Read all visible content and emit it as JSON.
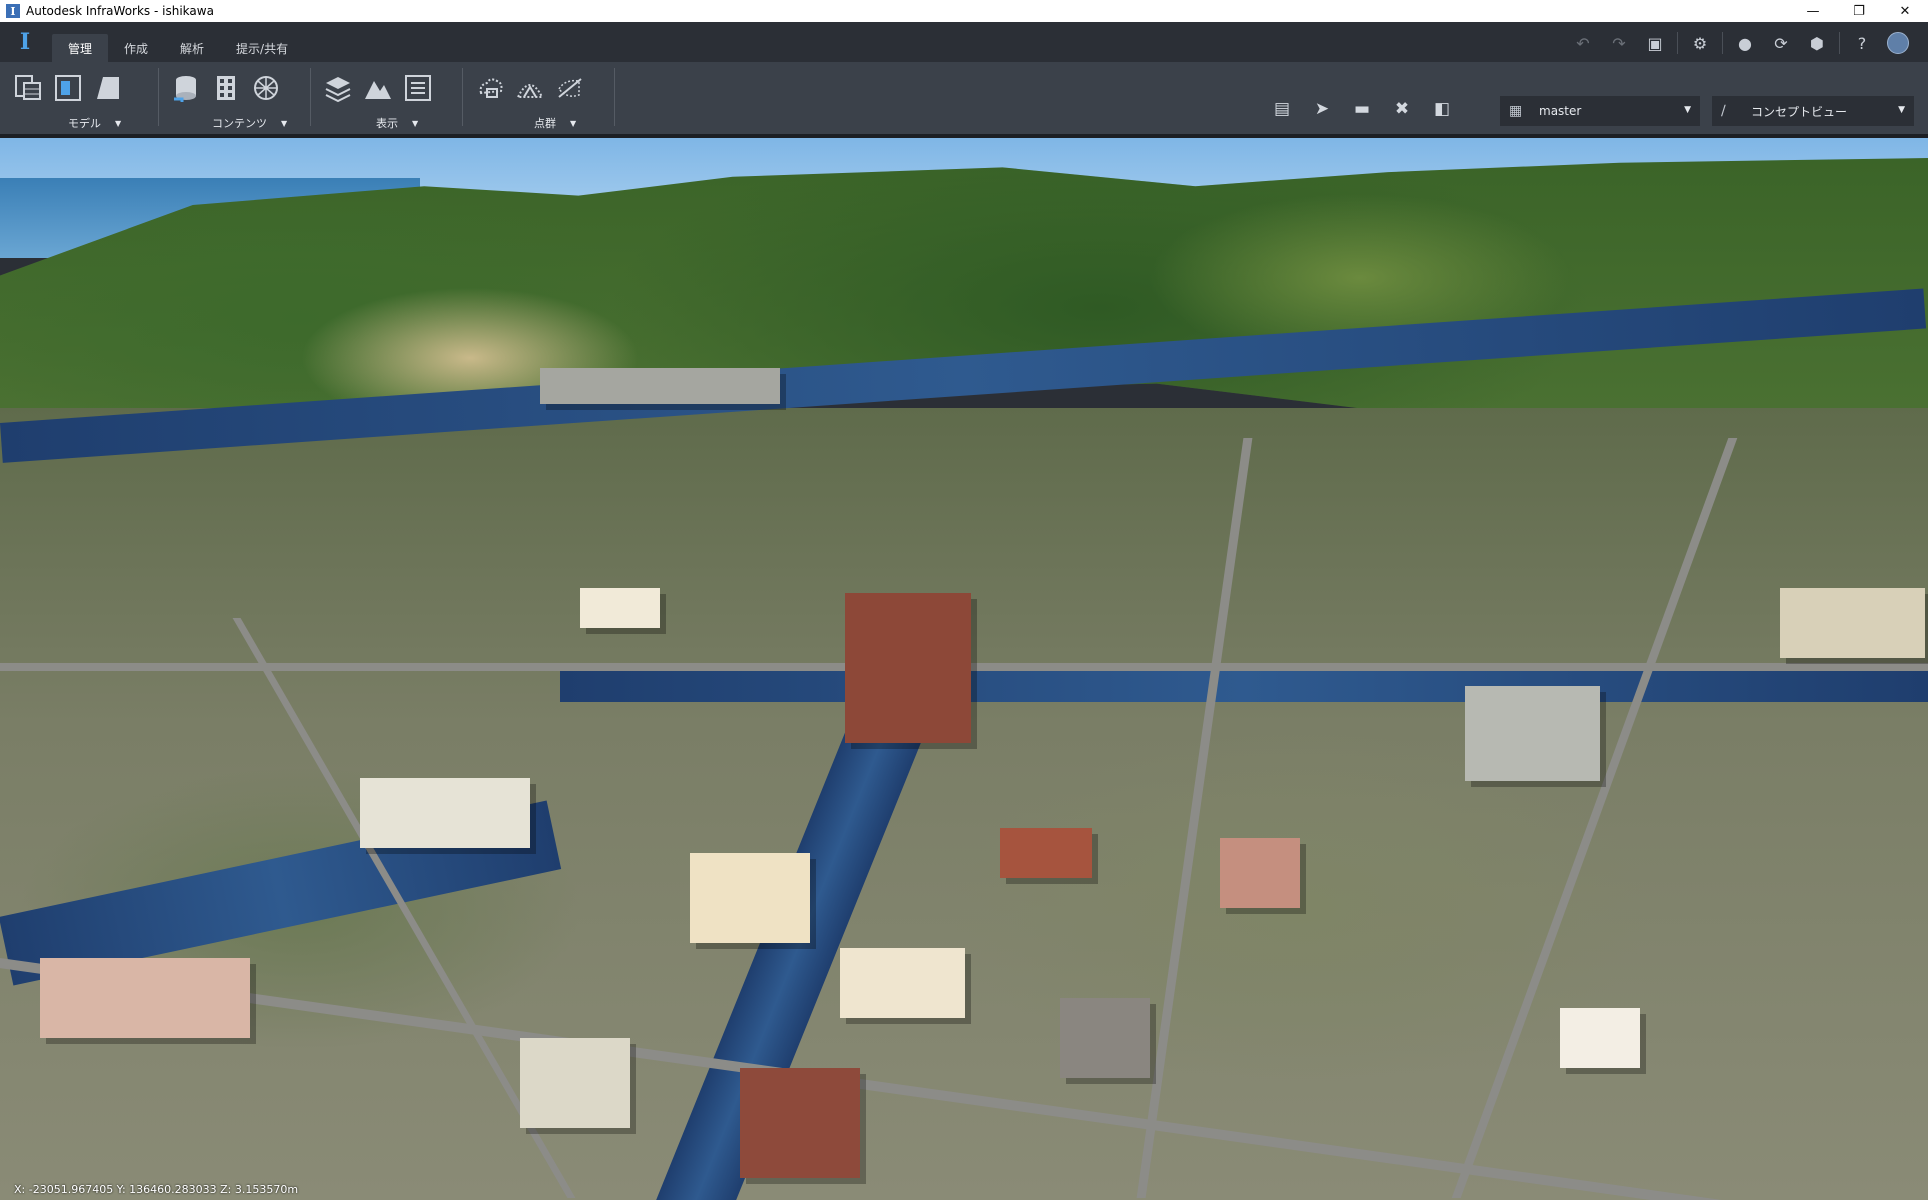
{
  "window": {
    "title": "Autodesk InfraWorks - ishikawa",
    "controls": [
      "minimize",
      "restore",
      "close"
    ]
  },
  "tabs": [
    {
      "label": "管理",
      "active": true
    },
    {
      "label": "作成",
      "active": false
    },
    {
      "label": "解析",
      "active": false
    },
    {
      "label": "提示/共有",
      "active": false
    }
  ],
  "top_icons": [
    "undo-icon",
    "redo-icon",
    "fit-view-icon",
    "settings-icon",
    "globe-icon",
    "sync-icon",
    "cube-icon",
    "help-icon",
    "user-avatar-icon"
  ],
  "ribbon": {
    "groups": [
      {
        "label": "モデル",
        "icons": [
          "model-table-icon",
          "model-panel-icon",
          "model-sheet-icon"
        ]
      },
      {
        "label": "コンテンツ",
        "icons": [
          "data-source-icon",
          "building-data-icon",
          "network-icon"
        ]
      },
      {
        "label": "表示",
        "icons": [
          "layers-icon",
          "terrain-icon",
          "list-icon"
        ]
      },
      {
        "label": "点群",
        "icons": [
          "point-cloud-icon",
          "surface-icon",
          "cloud-edit-icon"
        ]
      }
    ],
    "tools": [
      "view-tool-icon",
      "select-tool-icon",
      "measure-tool-icon",
      "cross-tool-icon",
      "split-tool-icon"
    ],
    "proposal_dropdown": {
      "value": "master"
    },
    "style_dropdown": {
      "value": "コンセプトビュー"
    }
  },
  "status": {
    "coordinates": "X: -23051.967405 Y: 136460.283033 Z: 3.153570m"
  },
  "colors": {
    "titlebar": "#ffffff",
    "tabbar": "#2b2f36",
    "ribbon": "#3b414a",
    "accent": "#4ea2e8"
  }
}
